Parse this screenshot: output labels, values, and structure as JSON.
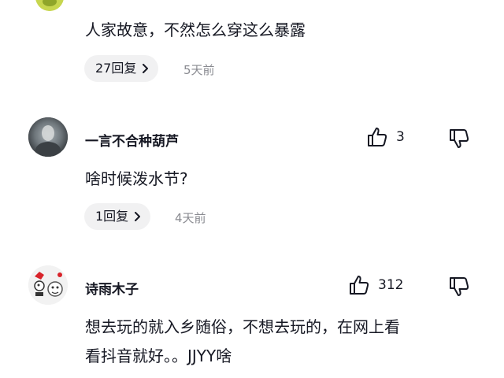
{
  "comments": [
    {
      "body_line1": "人家故意，不然怎么穿这么暴露",
      "reply_label": "27回复",
      "timestamp": "5天前",
      "avatar_icon": "avatar-green-icon"
    },
    {
      "username": "一言不合种葫芦",
      "like_count": "3",
      "body_line1": "啥时候泼水节?",
      "reply_label": "1回复",
      "timestamp": "4天前",
      "avatar_icon": "avatar-photo-icon"
    },
    {
      "username": "诗雨木子",
      "like_count": "312",
      "body_line1": "想去玩的就入乡随俗，不想去玩的，在网上看",
      "body_line2": "看抖音就好。。JJYY啥",
      "avatar_icon": "avatar-cartoon-icon"
    }
  ],
  "icons": {
    "like": "thumbs-up-icon",
    "dislike": "thumbs-down-icon",
    "chevron": "chevron-right-icon"
  },
  "colors": {
    "pill_bg": "#f1f1f2",
    "timestamp": "#8a8b91",
    "text": "#161823",
    "avatar_green": "#c7d64f"
  }
}
